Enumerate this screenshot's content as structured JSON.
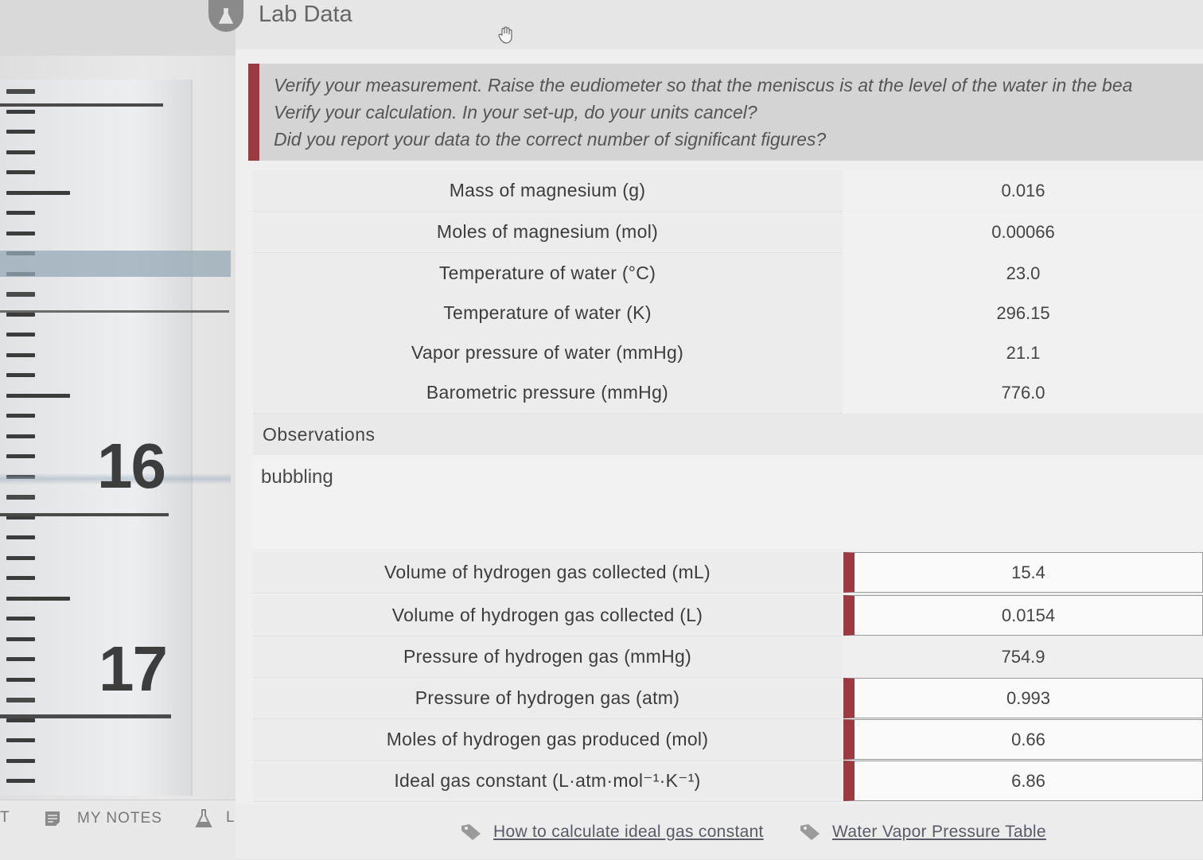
{
  "header": {
    "title": "Lab Data"
  },
  "feedback": {
    "lines": [
      "Verify your measurement. Raise the eudiometer so that the meniscus is at the level of the water in the bea",
      "Verify your calculation. In your set-up, do your units cancel?",
      "Did you report your data to the correct number of significant figures?"
    ]
  },
  "given_data": [
    {
      "label": "Mass of magnesium (g)",
      "value": "0.016"
    },
    {
      "label": "Moles of magnesium (mol)",
      "value": "0.00066"
    },
    {
      "label": "Temperature of water (°C)",
      "value": "23.0"
    },
    {
      "label": "Temperature of water (K)",
      "value": "296.15"
    },
    {
      "label": "Vapor pressure of water (mmHg)",
      "value": "21.1"
    },
    {
      "label": "Barometric pressure (mmHg)",
      "value": "776.0"
    }
  ],
  "observations": {
    "label": "Observations",
    "text": "bubbling"
  },
  "results": [
    {
      "label": "Volume of hydrogen gas collected (mL)",
      "value": "15.4"
    },
    {
      "label": "Volume of hydrogen gas collected (L)",
      "value": "0.0154"
    },
    {
      "label": "Pressure of hydrogen gas (mmHg)",
      "value": "754.9"
    },
    {
      "label": "Pressure of hydrogen gas (atm)",
      "value": "0.993"
    },
    {
      "label": "Moles of hydrogen gas produced (mol)",
      "value": "0.66"
    },
    {
      "label": "Ideal gas constant (L·atm·mol⁻¹·K⁻¹)",
      "value": "6.86"
    }
  ],
  "links": {
    "ideal_gas": "How to calculate ideal gas constant",
    "vapor_table": "Water Vapor Pressure Table"
  },
  "left_panel": {
    "scale_numbers": [
      "16",
      "17"
    ],
    "notes_label": "MY NOTES",
    "edge_left": "T",
    "edge_right": "L"
  },
  "colors": {
    "error_accent": "#9b3b41"
  }
}
